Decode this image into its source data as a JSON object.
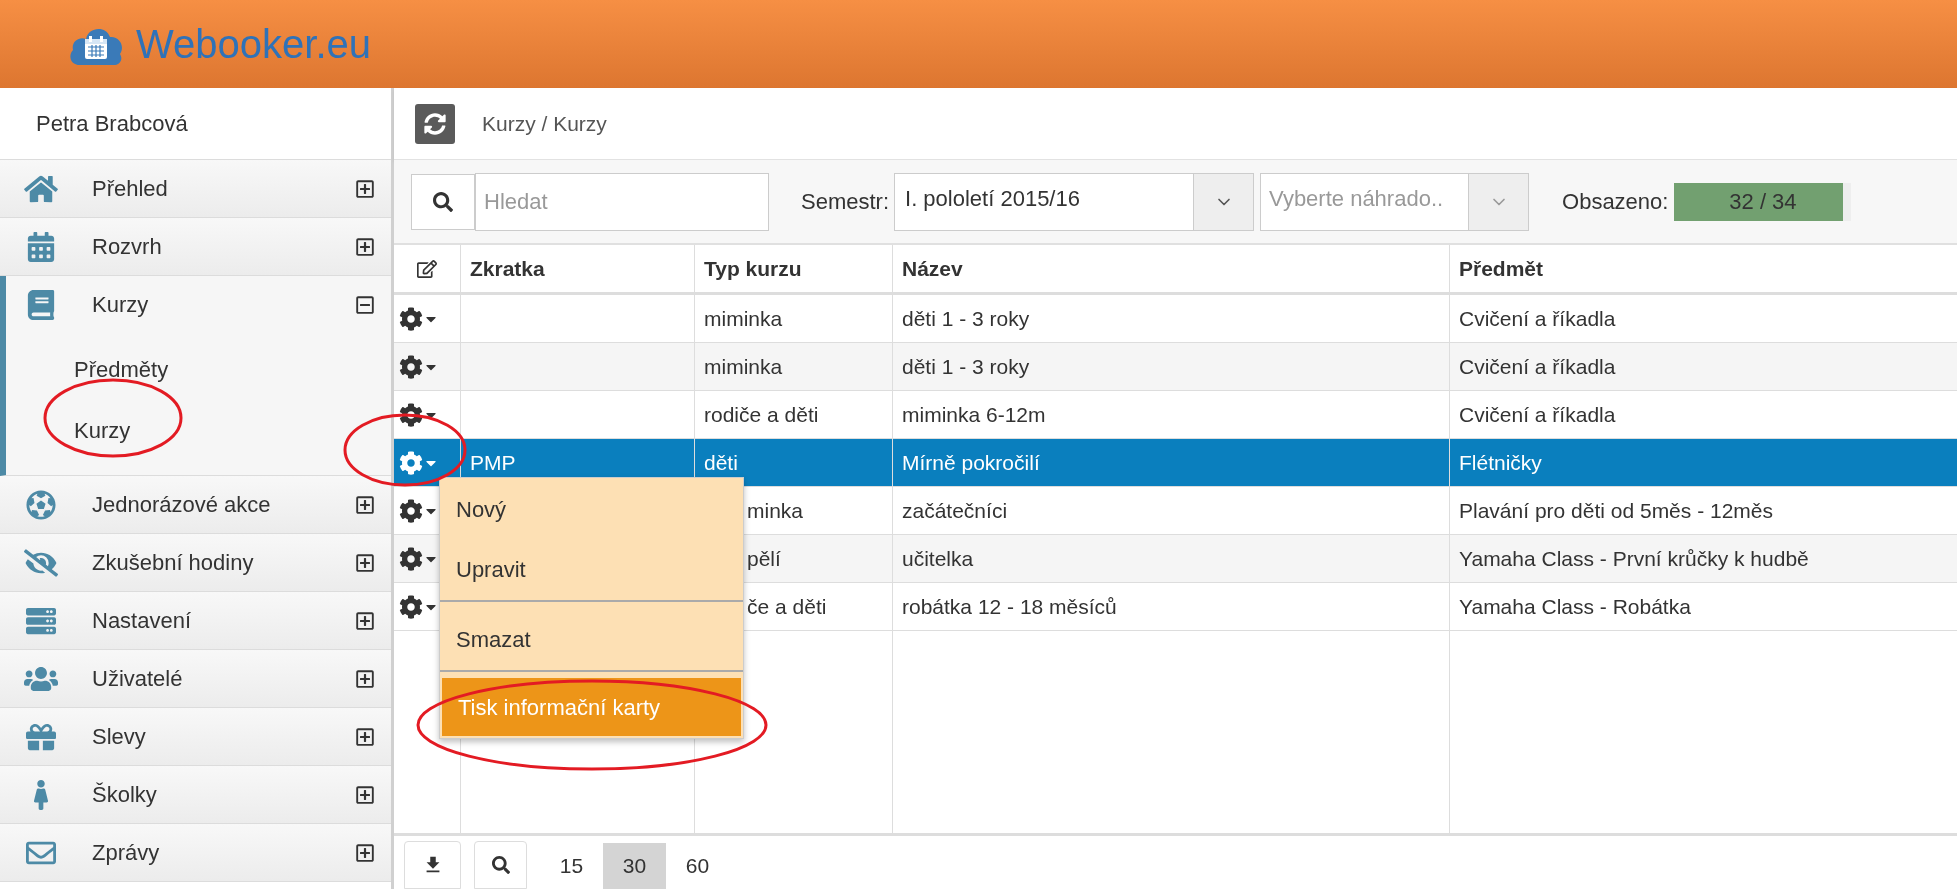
{
  "header": {
    "logo_text": "Webooker.eu"
  },
  "sidebar": {
    "user": "Petra Brabcová",
    "items": [
      {
        "label": "Přehled",
        "expanded": false
      },
      {
        "label": "Rozvrh",
        "expanded": false
      },
      {
        "label": "Kurzy",
        "expanded": true,
        "children": [
          {
            "label": "Předměty"
          },
          {
            "label": "Kurzy"
          }
        ]
      },
      {
        "label": "Jednorázové akce",
        "expanded": false
      },
      {
        "label": "Zkušební hodiny",
        "expanded": false
      },
      {
        "label": "Nastavení",
        "expanded": false
      },
      {
        "label": "Uživatelé",
        "expanded": false
      },
      {
        "label": "Slevy",
        "expanded": false
      },
      {
        "label": "Školky",
        "expanded": false
      },
      {
        "label": "Zprávy",
        "expanded": false
      }
    ]
  },
  "breadcrumb": "Kurzy / Kurzy",
  "toolbar": {
    "search": {
      "placeholder": "Hledat"
    },
    "semester_label": "Semestr:",
    "semester_value": "I. pololetí 2015/16",
    "substitute": {
      "placeholder": "Vyberte náhrado.."
    },
    "occupancy_label": "Obsazeno:",
    "occupancy": {
      "reading": "32 / 34",
      "level": 0.95
    }
  },
  "table": {
    "columns": [
      "Zkratka",
      "Typ kurzu",
      "Název",
      "Předmět"
    ],
    "rows": [
      {
        "cells": [
          "",
          "miminka",
          "děti 1 - 3 roky",
          "Cvičení a říkadla"
        ],
        "selected": false
      },
      {
        "cells": [
          "",
          "miminka",
          "děti 1 - 3 roky",
          "Cvičení a říkadla"
        ],
        "selected": false
      },
      {
        "cells": [
          "",
          "rodiče a děti",
          "miminka 6-12m",
          "Cvičení a říkadla"
        ],
        "selected": false
      },
      {
        "cells": [
          "PMP",
          "děti",
          "Mírně pokročilí",
          "Flétničky"
        ],
        "selected": true
      },
      {
        "cells": [
          "",
          "minka",
          "začátečníci",
          "Plavání pro děti od 5měs - 12měs"
        ],
        "selected": false
      },
      {
        "cells": [
          "",
          "pělí",
          "učitelka",
          "Yamaha Class - První krůčky k hudbě"
        ],
        "selected": false
      },
      {
        "cells": [
          "",
          "če a děti",
          "robátka 12 - 18 měsíců",
          "Yamaha Class - Robátka"
        ],
        "selected": false
      }
    ]
  },
  "row_menu": {
    "items": [
      {
        "label": "Nový",
        "selected": false,
        "divider_after": false
      },
      {
        "label": "Upravit",
        "selected": false,
        "divider_after": true
      },
      {
        "label": "Smazat",
        "selected": false,
        "divider_after": true
      },
      {
        "label": "Tisk informační karty",
        "selected": true,
        "divider_after": false
      }
    ]
  },
  "pagination": {
    "page_sizes": [
      {
        "label": "15",
        "selected": false
      },
      {
        "label": "30",
        "selected": true
      },
      {
        "label": "60",
        "selected": false
      }
    ]
  }
}
